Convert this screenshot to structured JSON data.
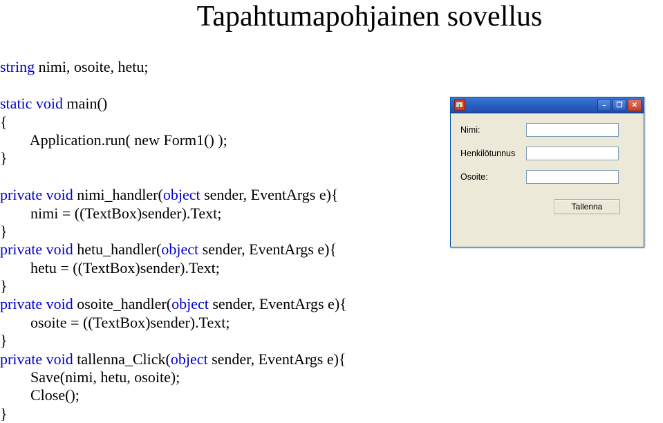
{
  "title": "Tapahtumapohjainen sovellus",
  "code": {
    "l1a": "string",
    "l1b": " nimi, osoite, hetu;",
    "l2a": "static void",
    "l2b": " main()",
    "l3": "{",
    "l4": "        Application.run( new Form1() );",
    "l5": "}",
    "l6a": "private void",
    "l6b": " nimi_handler(",
    "l6c": "object",
    "l6d": " sender, EventArgs e){",
    "l7": "        nimi = ((TextBox)sender).Text;",
    "l8": "}",
    "l9a": "private void",
    "l9b": " hetu_handler(",
    "l9c": "object",
    "l9d": " sender, EventArgs e){",
    "l10": "        hetu = ((TextBox)sender).Text;",
    "l11": "}",
    "l12a": "private void",
    "l12b": " osoite_handler(",
    "l12c": "object",
    "l12d": " sender, EventArgs e){",
    "l13": "        osoite = ((TextBox)sender).Text;",
    "l14": "}",
    "l15a": "private void",
    "l15b": " tallenna_Click(",
    "l15c": "object",
    "l15d": " sender, EventArgs e){",
    "l16": "        Save(nimi, hetu, osoite);",
    "l17": "        Close();",
    "l18": "}"
  },
  "window": {
    "labels": {
      "nimi": "Nimi:",
      "hetu": "Henkilötunnus",
      "osoite": "Osoite:"
    },
    "button": "Tallenna",
    "controls": {
      "min": "–",
      "max": "❐",
      "close": "✕"
    }
  }
}
